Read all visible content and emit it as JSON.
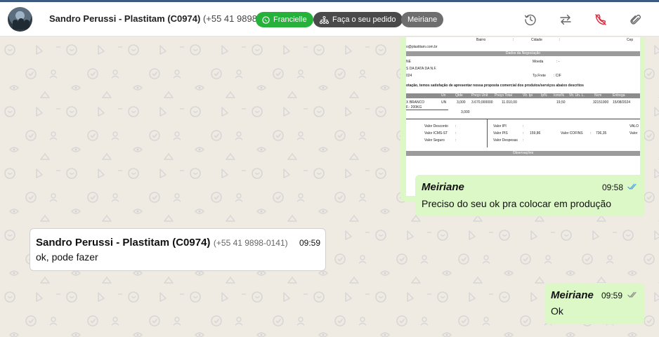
{
  "header": {
    "contact_name": "Sandro Perussi - Plastitam (C0974)",
    "contact_phone": "(+55 41 9898-0141)",
    "tags": {
      "agent": "Francielle",
      "order": "Faça o seu pedido",
      "user": "Meiriane"
    },
    "icons": [
      "history-icon",
      "transfer-icon",
      "end-call-icon",
      "attachment-icon"
    ]
  },
  "document": {
    "address_fields": [
      "Bairro",
      ":",
      "Cidade",
      ":",
      "Cep"
    ],
    "email_fragment": "o@plastitam.com.br",
    "section_negotiation": "Dados da Negociação",
    "moeda_label": "Moeda",
    "moeda_value": ": -",
    "ne_fragment": "NE",
    "data_nf": "S DA DATA DA N.F.",
    "year_fragment": "024",
    "tp_frete_label": "Tp.Frete",
    "tp_frete_value": ":  CIF",
    "intro_text": "otação, temos satisfação de apresentar nossa proposta comercial dos produtos/serviços abaixo descritos",
    "table_headers": [
      "Un",
      "Qtde",
      "Preço Unit",
      "Preço Total",
      "Vlr. Ipi",
      "Ip%",
      "Icms%",
      "Vlr. Un. L.",
      "Ncm",
      "Entrega"
    ],
    "item_desc_1": "X BRANCO",
    "item_desc_2": "F.: 200KG",
    "item_values": [
      "UN",
      "3,000",
      "3.670,000000",
      "11.010,00",
      "19,50",
      "32151900",
      "15/08/2024"
    ],
    "item_total_qty": "3,000",
    "totals": {
      "desconto": "Valor Desconto",
      "icms_st": "Valor ICMS-ST",
      "seguro": "Valor Seguro",
      "ipi": "Valor IPI",
      "pis": "Valor PIS",
      "pis_value": "159,86",
      "cofins": "Valor COFINS",
      "cofins_value": "736,35",
      "despesas": "Valor Despesas",
      "valo_trunc": "VALO",
      "valor_trunc": "Valor",
      "colon": ":"
    },
    "section_observacoes": "Observações"
  },
  "messages": [
    {
      "direction": "out",
      "sender": "Meiriane",
      "time": "09:58",
      "text": "Preciso do seu ok pra colocar em produção",
      "status": "read",
      "status_color": "#4fa3e0"
    },
    {
      "direction": "in",
      "sender": "Sandro Perussi - Plastitam (C0974)",
      "sender_phone": "(+55 41 9898-0141)",
      "time": "09:59",
      "text": "ok, pode fazer"
    },
    {
      "direction": "out",
      "sender": "Meiriane",
      "time": "09:59",
      "text": "Ok",
      "status": "delivered",
      "status_color": "#8a8a8a"
    }
  ],
  "colors": {
    "chat_bg": "#efeae2",
    "outgoing_bubble": "#dcf8c6",
    "incoming_bubble": "#ffffff",
    "whatsapp_green": "#25b13a",
    "end_call_red": "#e0283c"
  }
}
